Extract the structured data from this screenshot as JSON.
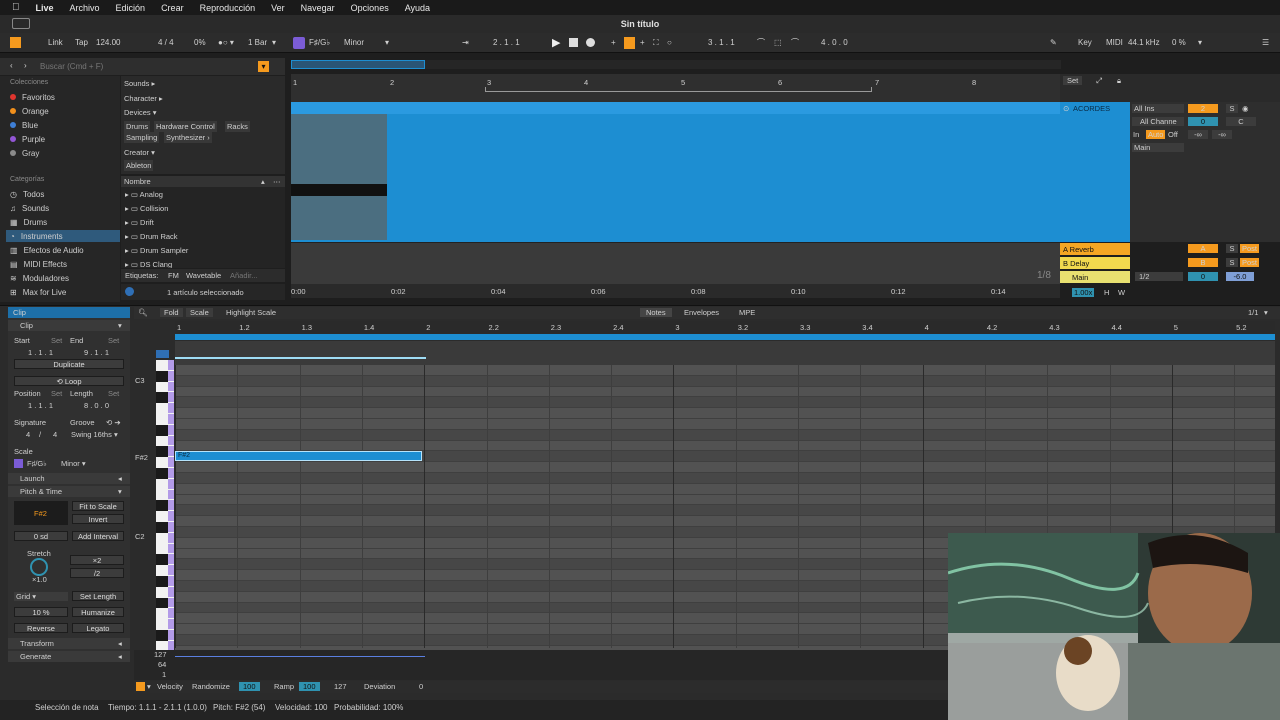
{
  "menu": {
    "app": "Live",
    "items": [
      "Archivo",
      "Edición",
      "Crear",
      "Reproducción",
      "Ver",
      "Navegar",
      "Opciones",
      "Ayuda"
    ]
  },
  "window_title": "Sin título",
  "transport": {
    "link": "Link",
    "tap": "Tap",
    "tempo": "124.00",
    "signature": "4 / 4",
    "cpu": "0%",
    "quantize": "1 Bar",
    "scale_root": "F♯/G♭",
    "scale_mode": "Minor",
    "position": "2 . 1 . 1",
    "loop_start": "3 . 1 . 1",
    "loop_length": "4 . 0 . 0",
    "key": "Key",
    "midi": "MIDI",
    "sample_rate": "44.1 kHz",
    "load": "0 %"
  },
  "browser": {
    "search_placeholder": "Buscar (Cmd + F)",
    "colecciones_header": "Colecciones",
    "collections": [
      {
        "label": "Favoritos",
        "color": "#e0352e"
      },
      {
        "label": "Orange",
        "color": "#f2901c"
      },
      {
        "label": "Blue",
        "color": "#3e7fd6"
      },
      {
        "label": "Purple",
        "color": "#9356d6"
      },
      {
        "label": "Gray",
        "color": "#8a8a8a"
      }
    ],
    "categorias_header": "Categorías",
    "categories": [
      "Todos",
      "Sounds",
      "Drums",
      "Instruments",
      "Efectos de Audio",
      "MIDI Effects",
      "Moduladores",
      "Max for Live"
    ],
    "filters": {
      "sounds": "Sounds ▸",
      "character": "Character ▸",
      "devices": "Devices ▾",
      "device_tags": [
        "Drums",
        "Hardware Control",
        "Racks",
        "Sampling",
        "Synthesizer ›"
      ],
      "creator": "Creator ▾",
      "creator_tag": "Ableton"
    },
    "list_header": "Nombre",
    "list": [
      "Analog",
      "Collision",
      "Drift",
      "Drum Rack",
      "Drum Sampler",
      "DS Clang"
    ],
    "tags_label": "Etiquetas:",
    "tags": [
      "FM",
      "Wavetable",
      "Añadir..."
    ],
    "selection_info": "1 artículo seleccionado"
  },
  "arrangement": {
    "bar_markers": [
      "1",
      "2",
      "3",
      "4",
      "5",
      "6",
      "7",
      "8"
    ],
    "time_markers": [
      "0:00",
      "0:02",
      "0:04",
      "0:06",
      "0:08",
      "0:10",
      "0:12",
      "0:14"
    ],
    "zoom_label": "1/8",
    "set_label": "Set"
  },
  "mixer": {
    "track_name": "ACORDES",
    "input": "All Ins",
    "channel": "All Channe",
    "monitor": [
      "In",
      "Auto",
      "Off"
    ],
    "output": "Main",
    "track_number": "2",
    "solo": "S",
    "pan": "C",
    "volume": "0",
    "returns": [
      {
        "name": "A Reverb",
        "letter": "A",
        "post": "Post",
        "color": "#f5a623"
      },
      {
        "name": "B Delay",
        "letter": "B",
        "post": "Post",
        "color": "#f2d94e"
      },
      {
        "name": "Main",
        "letter": "1/2",
        "post": "Post",
        "color": "#e8e070"
      }
    ],
    "main_volume": "0",
    "main_db": "-6.0",
    "neg_inf": "-∞",
    "zoom": "1.00x",
    "h": "H",
    "w": "W"
  },
  "clip": {
    "header": "Clip",
    "clip_title": "Clip",
    "start_label": "Start",
    "end_label": "End",
    "set": "Set",
    "start_value": "1 . 1 . 1",
    "end_value": "9 . 1 . 1",
    "duplicate": "Duplicate",
    "loop": "Loop",
    "position_label": "Position",
    "length_label": "Length",
    "position_value": "1 . 1 . 1",
    "length_value": "8 . 0 . 0",
    "signature_label": "Signature",
    "groove_label": "Groove",
    "sig_num": "4",
    "sig_den": "4",
    "groove_value": "Swing 16ths",
    "scale_label": "Scale",
    "scale_root": "F♯/G♭",
    "scale_mode": "Minor",
    "launch": "Launch",
    "pitch_time": "Pitch & Time",
    "pitch_value": "F#2",
    "fit_to_scale": "Fit to Scale",
    "invert": "Invert",
    "semitones": "0 sd",
    "add_interval": "Add Interval",
    "stretch_label": "Stretch",
    "double": "×2",
    "half": "/2",
    "stretch_value": "×1.0",
    "grid_label": "Grid",
    "set_length": "Set Length",
    "percent": "10 %",
    "humanize": "Humanize",
    "reverse": "Reverse",
    "legato": "Legato",
    "transform": "Transform",
    "generate": "Generate"
  },
  "editor": {
    "fold": "Fold",
    "scale": "Scale",
    "highlight_scale": "Highlight Scale",
    "tabs": [
      "Notes",
      "Envelopes",
      "MPE"
    ],
    "page": "1/1",
    "ruler": [
      "1",
      "1.2",
      "1.3",
      "1.4",
      "2",
      "2.2",
      "2.3",
      "2.4",
      "3",
      "3.2",
      "3.3",
      "3.4",
      "4",
      "4.2",
      "4.3",
      "4.4",
      "5",
      "5.2"
    ],
    "note_labels": [
      "C3",
      "F#2",
      "C2"
    ],
    "note_text": "F#2",
    "velocity_values": [
      "127",
      "64",
      "1"
    ],
    "velocity_label": "Velocity",
    "randomize": "Randomize",
    "randomize_value": "100",
    "ramp": "Ramp",
    "ramp_value": "100",
    "ramp_value2": "127",
    "deviation": "Deviation",
    "deviation_value": "0"
  },
  "status": {
    "text": "Selección de nota",
    "tiempo": "Tiempo: 1.1.1 - 2.1.1 (1.0.0)",
    "pitch": "Pitch: F#2 (54)",
    "velocidad": "Velocidad: 100",
    "probabilidad": "Probabilidad: 100%"
  }
}
